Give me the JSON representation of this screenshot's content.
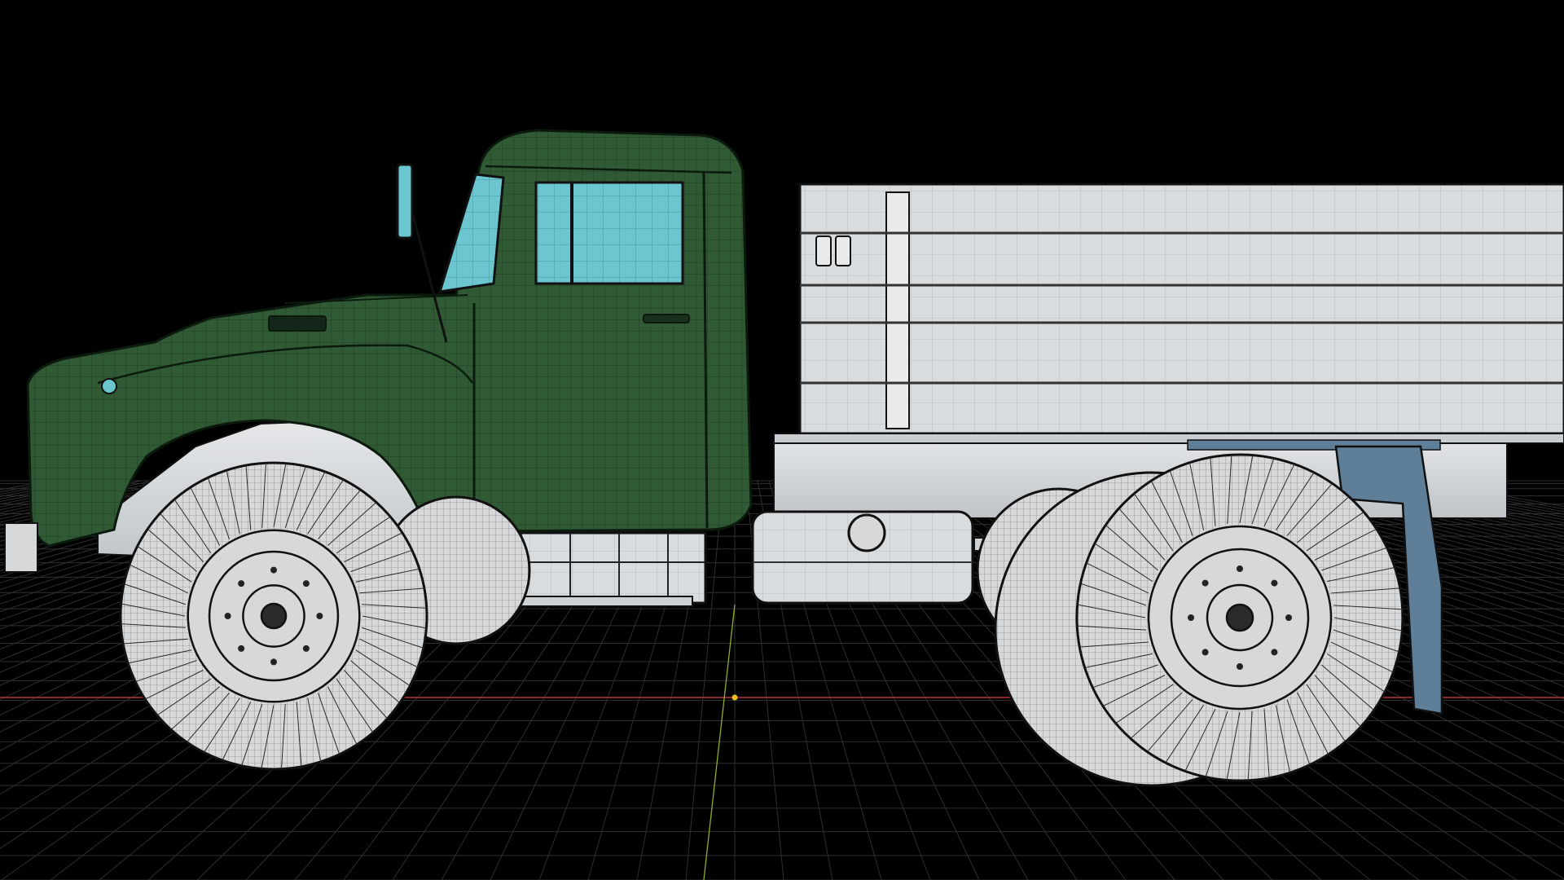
{
  "viewport": {
    "background": "#000000",
    "grid_color": "#2f2f2f",
    "x_axis_color": "#b8323c",
    "y_axis_color": "#8fae2a",
    "origin_color": "#f0c020"
  },
  "model": {
    "cab_color": "#2f5a34",
    "cab_dark": "#203f25",
    "glass_color": "#6cc6cf",
    "body_color": "#d9dcde",
    "body_dark": "#b8bcc0",
    "chassis_color": "#5f7f99",
    "tire_color": "#d6d8da",
    "wire_color": "#111111",
    "icons": [
      "truck-cab",
      "cargo-bed",
      "wheel",
      "fuel-tank",
      "mirror"
    ]
  }
}
